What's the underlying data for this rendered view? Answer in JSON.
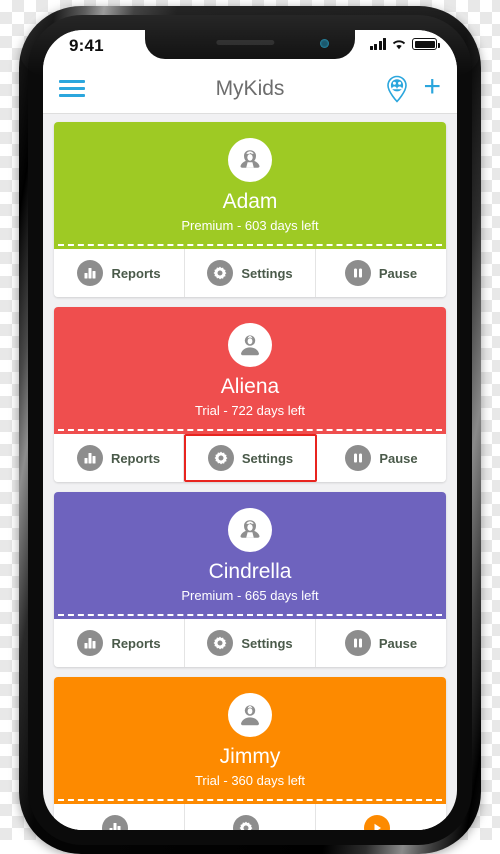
{
  "status_bar": {
    "time": "9:41",
    "signal_icon": "cellular-signal-icon",
    "wifi_icon": "wifi-icon",
    "battery_icon": "battery-full-icon"
  },
  "header": {
    "menu_icon": "hamburger-menu-icon",
    "title": "MyKids",
    "locator_icon": "family-locator-pin-icon",
    "add_label": "+"
  },
  "colors": {
    "accent": "#2BA6DD",
    "highlight": "#E8241F",
    "green": "#9ECA24",
    "red": "#EF4E4E",
    "purple": "#6E63BE",
    "orange": "#FD8A00",
    "icon_gray": "#8d8d8d"
  },
  "kids": [
    {
      "name": "Adam",
      "plan": "Premium - 603 days left",
      "color": "#9ECA24",
      "avatar_icon": "girl-avatar-icon",
      "actions": [
        {
          "label": "Reports",
          "icon": "bar-chart-icon",
          "highlight": false,
          "icon_color": "gray"
        },
        {
          "label": "Settings",
          "icon": "gear-icon",
          "highlight": false,
          "icon_color": "gray"
        },
        {
          "label": "Pause",
          "icon": "pause-icon",
          "highlight": false,
          "icon_color": "gray"
        }
      ]
    },
    {
      "name": "Aliena",
      "plan": "Trial - 722 days left",
      "color": "#EF4E4E",
      "avatar_icon": "boy-avatar-icon",
      "actions": [
        {
          "label": "Reports",
          "icon": "bar-chart-icon",
          "highlight": false,
          "icon_color": "gray"
        },
        {
          "label": "Settings",
          "icon": "gear-icon",
          "highlight": true,
          "icon_color": "gray"
        },
        {
          "label": "Pause",
          "icon": "pause-icon",
          "highlight": false,
          "icon_color": "gray"
        }
      ]
    },
    {
      "name": "Cindrella",
      "plan": "Premium - 665 days left",
      "color": "#6E63BE",
      "avatar_icon": "girl-avatar-icon",
      "actions": [
        {
          "label": "Reports",
          "icon": "bar-chart-icon",
          "highlight": false,
          "icon_color": "gray"
        },
        {
          "label": "Settings",
          "icon": "gear-icon",
          "highlight": false,
          "icon_color": "gray"
        },
        {
          "label": "Pause",
          "icon": "pause-icon",
          "highlight": false,
          "icon_color": "gray"
        }
      ]
    },
    {
      "name": "Jimmy",
      "plan": "Trial - 360 days left",
      "color": "#FD8A00",
      "avatar_icon": "boy-avatar-icon",
      "actions": [
        {
          "label": "",
          "icon": "bar-chart-icon",
          "highlight": false,
          "icon_color": "gray"
        },
        {
          "label": "",
          "icon": "gear-icon",
          "highlight": false,
          "icon_color": "gray"
        },
        {
          "label": "",
          "icon": "resume-icon",
          "highlight": false,
          "icon_color": "orange"
        }
      ]
    }
  ]
}
